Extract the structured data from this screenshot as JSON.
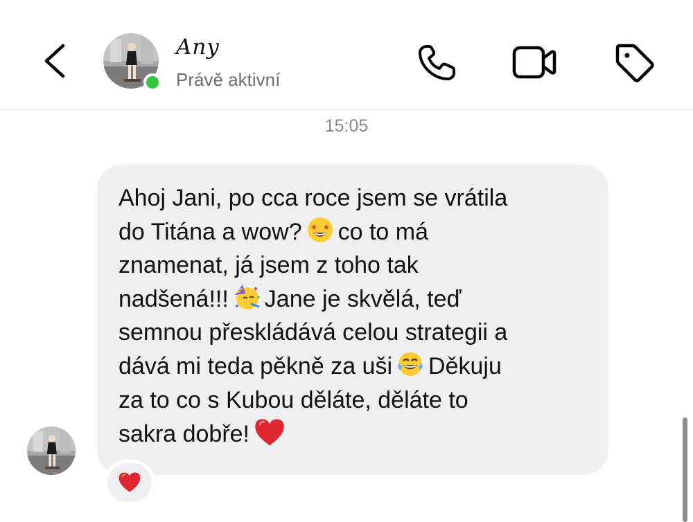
{
  "header": {
    "contact_name": "Any",
    "contact_status": "Právě aktivní",
    "online_color": "#31c740",
    "icons": [
      "chevron-left-icon",
      "phone-icon",
      "video-camera-icon",
      "tag-icon"
    ]
  },
  "thread": {
    "timestamp": "15:05",
    "message": {
      "lines": [
        "Ahoj Jani, po cca roce jsem se vrátila",
        "do Titána a wow?",
        "co to má",
        "znamenat, já jsem z toho tak",
        "nadšená!!!",
        "Jane je skvělá, teď",
        "semnou přeskládává celou strategii a",
        "dává mi teda pěkně za uši",
        "Děkuju",
        "za to co s Kubou děláte, děláte to",
        "sakra dobře!"
      ],
      "emojis": [
        "star-struck-emoji",
        "partying-face-emoji",
        "laughing-tears-emoji",
        "red-heart-emoji"
      ],
      "bubble_color": "#efeff1"
    },
    "reaction": {
      "emoji": "red-heart-emoji",
      "color": "#e0262f"
    }
  }
}
